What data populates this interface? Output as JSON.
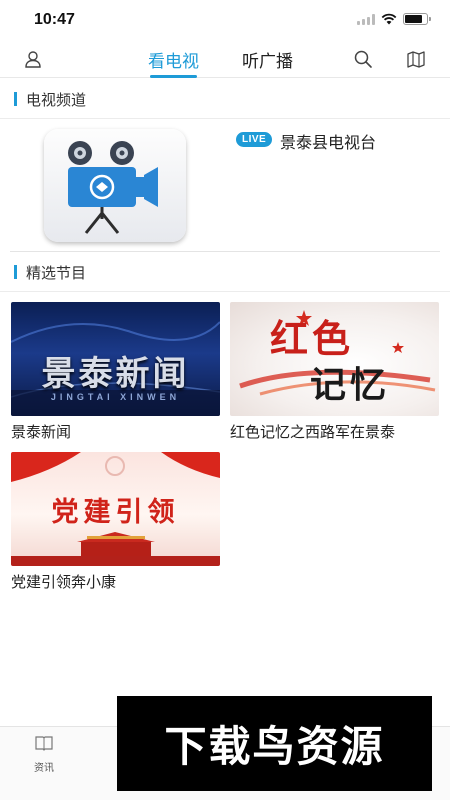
{
  "status_bar": {
    "time": "10:47"
  },
  "top_nav": {
    "tabs": [
      {
        "label": "看电视",
        "active": true
      },
      {
        "label": "听广播",
        "active": false
      }
    ],
    "accent": "#1e9bd7"
  },
  "sections": {
    "channels_title": "电视频道",
    "programs_title": "精选节目"
  },
  "channel": {
    "badge": "LIVE",
    "name": "景泰县电视台"
  },
  "programs": [
    {
      "title": "景泰新闻",
      "thumb_text": "景泰新闻",
      "thumb_subtext": "JINGTAI XINWEN"
    },
    {
      "title": "红色记忆之西路军在景泰",
      "thumb_text_1": "红色",
      "thumb_text_2": "记忆"
    },
    {
      "title": "党建引领奔小康",
      "thumb_text": "党建引领"
    }
  ],
  "tab_bar": {
    "items": [
      {
        "label": "资讯"
      }
    ]
  },
  "watermark": {
    "text": "下载鸟资源"
  }
}
